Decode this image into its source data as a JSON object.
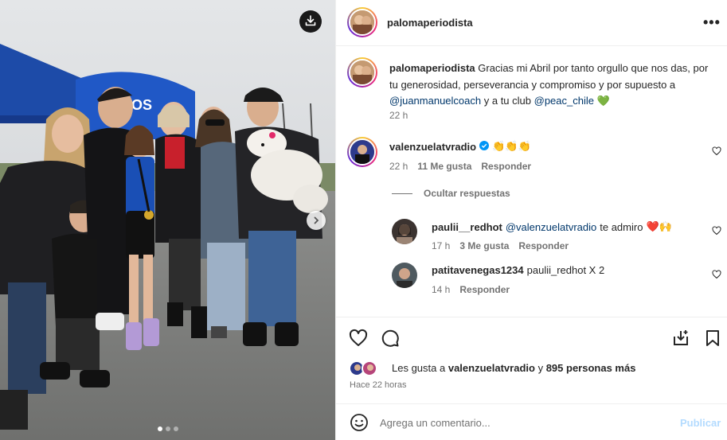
{
  "post": {
    "author": "palomaperiodista",
    "more_label": "•••"
  },
  "caption": {
    "author": "palomaperiodista",
    "text_1": "Gracias mi Abril por tanto orgullo que nos das, por tu generosidad, perseverancia y compromiso y por supuesto a",
    "mention_1": "@juanmanuelcoach",
    "text_2": "y a tu club",
    "mention_2": "@peac_chile",
    "emoji": "💚",
    "time": "22 h"
  },
  "comments": [
    {
      "user": "valenzuelatvradio",
      "verified": true,
      "text": "👏👏👏",
      "time": "22 h",
      "likes": "11 Me gusta",
      "reply": "Responder"
    }
  ],
  "hide_replies": "Ocultar respuestas",
  "replies": [
    {
      "user": "paulii__redhot",
      "mention": "@valenzuelatvradio",
      "text": "te admiro",
      "emoji": "❤️🙌",
      "time": "17 h",
      "likes": "3 Me gusta",
      "reply": "Responder"
    },
    {
      "user": "patitavenegas1234",
      "text": "paulii_redhot X 2",
      "time": "14 h",
      "reply": "Responder"
    }
  ],
  "likes": {
    "prefix": "Les gusta a",
    "user": "valenzuelatvradio",
    "middle": "y",
    "others": "895 personas más"
  },
  "time_ago": "Hace 22 horas",
  "comment_box": {
    "placeholder": "Agrega un comentario...",
    "publish": "Publicar"
  },
  "carousel": {
    "total": 3,
    "active": 0
  },
  "tent_text": "OS",
  "colors": {
    "link": "#00376b",
    "muted": "#737373",
    "verified": "#0095f6",
    "publish": "#b3dbff",
    "tent": "#1e4fb0"
  },
  "icons": [
    "download-icon",
    "chevron-right-icon",
    "more-icon",
    "heart-icon",
    "comment-icon",
    "save-to-collection-icon",
    "bookmark-icon",
    "emoji-icon",
    "verified-badge-icon"
  ]
}
